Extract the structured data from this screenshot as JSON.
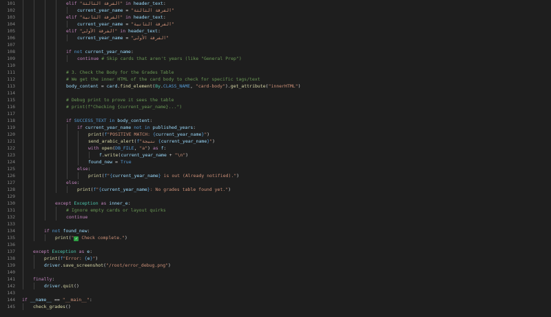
{
  "editor": {
    "lines": [
      {
        "n": "101",
        "indent": 96,
        "t": [
          [
            "elif ",
            "kw"
          ],
          [
            "\"الفرقة الثالثة\"",
            "str"
          ],
          [
            " in ",
            "kw"
          ],
          [
            "header_text",
            "var"
          ],
          [
            ":",
            ""
          ]
        ]
      },
      {
        "n": "102",
        "indent": 112,
        "t": [
          [
            "current_year_name",
            "var"
          ],
          [
            " = ",
            ""
          ],
          [
            "\"الفرقة الثالثة\"",
            "str"
          ]
        ]
      },
      {
        "n": "103",
        "indent": 96,
        "t": [
          [
            "elif ",
            "kw"
          ],
          [
            "\"الفرقة الثانية\"",
            "str"
          ],
          [
            " in ",
            "kw"
          ],
          [
            "header_text",
            "var"
          ],
          [
            ":",
            ""
          ]
        ]
      },
      {
        "n": "104",
        "indent": 112,
        "t": [
          [
            "current_year_name",
            "var"
          ],
          [
            " = ",
            ""
          ],
          [
            "\"الفرقة الثانية\"",
            "str"
          ]
        ]
      },
      {
        "n": "105",
        "indent": 96,
        "t": [
          [
            "elif ",
            "kw"
          ],
          [
            "\"الفرقة الأولى\"",
            "str"
          ],
          [
            " in ",
            "kw"
          ],
          [
            "header_text",
            "var"
          ],
          [
            ":",
            ""
          ]
        ]
      },
      {
        "n": "106",
        "indent": 112,
        "t": [
          [
            "current_year_name",
            "var"
          ],
          [
            " = ",
            ""
          ],
          [
            "\"الفرقة الأولى\"",
            "str"
          ]
        ]
      },
      {
        "n": "107",
        "indent": 0,
        "t": []
      },
      {
        "n": "108",
        "indent": 96,
        "t": [
          [
            "if ",
            "kw"
          ],
          [
            "not ",
            "kb"
          ],
          [
            "current_year_name",
            "var"
          ],
          [
            ":",
            ""
          ]
        ]
      },
      {
        "n": "109",
        "indent": 112,
        "t": [
          [
            "continue ",
            "kw"
          ],
          [
            "# Skip cards that aren't years (like \"General Prep\")",
            "cm"
          ]
        ]
      },
      {
        "n": "110",
        "indent": 0,
        "t": []
      },
      {
        "n": "111",
        "indent": 96,
        "t": [
          [
            "# 3. Check the Body for the Grades Table",
            "cm"
          ]
        ]
      },
      {
        "n": "112",
        "indent": 96,
        "t": [
          [
            "# We get the inner HTML of the card body to check for specific tags/text",
            "cm"
          ]
        ]
      },
      {
        "n": "113",
        "indent": 96,
        "t": [
          [
            "body_content",
            "var"
          ],
          [
            " = ",
            ""
          ],
          [
            "card",
            "var"
          ],
          [
            ".",
            ""
          ],
          [
            "find_element",
            "fn"
          ],
          [
            "(",
            ""
          ],
          [
            "By",
            "cls"
          ],
          [
            ".",
            ""
          ],
          [
            "CLASS_NAME",
            "kb"
          ],
          [
            ", ",
            ""
          ],
          [
            "\"card-body\"",
            "str"
          ],
          [
            ").",
            ""
          ],
          [
            "get_attribute",
            "fn"
          ],
          [
            "(",
            ""
          ],
          [
            "\"innerHTML\"",
            "str"
          ],
          [
            ")",
            ""
          ]
        ]
      },
      {
        "n": "114",
        "indent": 0,
        "t": []
      },
      {
        "n": "115",
        "indent": 96,
        "t": [
          [
            "# Debug print to prove it sees the table",
            "cm"
          ]
        ]
      },
      {
        "n": "116",
        "indent": 96,
        "t": [
          [
            "# print(f\"Checking {current_year_name}...\")",
            "cm"
          ]
        ]
      },
      {
        "n": "117",
        "indent": 0,
        "t": []
      },
      {
        "n": "118",
        "indent": 96,
        "t": [
          [
            "if ",
            "kw"
          ],
          [
            "SUCCESS_TEXT",
            "kb"
          ],
          [
            " in ",
            "kb"
          ],
          [
            "body_content",
            "var"
          ],
          [
            ":",
            ""
          ]
        ]
      },
      {
        "n": "119",
        "indent": 112,
        "t": [
          [
            "if ",
            "kw"
          ],
          [
            "current_year_name",
            "var"
          ],
          [
            " not in ",
            "kb"
          ],
          [
            "published_years",
            "var"
          ],
          [
            ":",
            ""
          ]
        ]
      },
      {
        "n": "120",
        "indent": 128,
        "t": [
          [
            "print",
            "fn"
          ],
          [
            "(",
            ""
          ],
          [
            "f",
            "kb"
          ],
          [
            "\"POSITIVE MATCH: ",
            "str"
          ],
          [
            "{",
            "brace"
          ],
          [
            "current_year_name",
            "var"
          ],
          [
            "}",
            "brace"
          ],
          [
            "\"",
            "str"
          ],
          [
            ")",
            ""
          ]
        ]
      },
      {
        "n": "121",
        "indent": 128,
        "t": [
          [
            "send_arabic_alert",
            "fn"
          ],
          [
            "(",
            ""
          ],
          [
            "f",
            "kb"
          ],
          [
            "\"نتيجة ",
            "str"
          ],
          [
            "{",
            "brace"
          ],
          [
            "current_year_name",
            "var"
          ],
          [
            "}",
            "brace"
          ],
          [
            "\"",
            "str"
          ],
          [
            ")",
            ""
          ]
        ]
      },
      {
        "n": "122",
        "indent": 128,
        "t": [
          [
            "with ",
            "kw"
          ],
          [
            "open",
            "fn"
          ],
          [
            "(",
            ""
          ],
          [
            "DB_FILE",
            "kb"
          ],
          [
            ", ",
            ""
          ],
          [
            "\"a\"",
            "str"
          ],
          [
            ") ",
            ""
          ],
          [
            "as ",
            "kw"
          ],
          [
            "f",
            "var"
          ],
          [
            ":",
            ""
          ]
        ]
      },
      {
        "n": "123",
        "indent": 144,
        "t": [
          [
            "f",
            "var"
          ],
          [
            ".",
            ""
          ],
          [
            "write",
            "fn"
          ],
          [
            "(",
            ""
          ],
          [
            "current_year_name",
            "var"
          ],
          [
            " + ",
            ""
          ],
          [
            "\"\\n\"",
            "str"
          ],
          [
            ")",
            ""
          ]
        ]
      },
      {
        "n": "124",
        "indent": 128,
        "t": [
          [
            "found_new",
            "var"
          ],
          [
            " = ",
            ""
          ],
          [
            "True",
            "kb"
          ]
        ]
      },
      {
        "n": "125",
        "indent": 112,
        "t": [
          [
            "else",
            "kw"
          ],
          [
            ":",
            ""
          ]
        ]
      },
      {
        "n": "126",
        "indent": 128,
        "t": [
          [
            "print",
            "fn"
          ],
          [
            "(",
            ""
          ],
          [
            "f",
            "kb"
          ],
          [
            "\"",
            "str"
          ],
          [
            "{",
            "brace"
          ],
          [
            "current_year_name",
            "var"
          ],
          [
            "}",
            "brace"
          ],
          [
            " is out (Already notified).\"",
            "str"
          ],
          [
            ")",
            ""
          ]
        ]
      },
      {
        "n": "127",
        "indent": 96,
        "t": [
          [
            "else",
            "kw"
          ],
          [
            ":",
            ""
          ]
        ]
      },
      {
        "n": "128",
        "indent": 112,
        "t": [
          [
            "print",
            "fn"
          ],
          [
            "(",
            ""
          ],
          [
            "f",
            "kb"
          ],
          [
            "\"",
            "str"
          ],
          [
            "{",
            "brace"
          ],
          [
            "current_year_name",
            "var"
          ],
          [
            "}",
            "brace"
          ],
          [
            ": No grades table found yet.\"",
            "str"
          ],
          [
            ")",
            ""
          ]
        ]
      },
      {
        "n": "129",
        "indent": 0,
        "t": []
      },
      {
        "n": "130",
        "indent": 80,
        "t": [
          [
            "except ",
            "kw"
          ],
          [
            "Exception",
            "cls"
          ],
          [
            " as ",
            "kw"
          ],
          [
            "inner_e",
            "var"
          ],
          [
            ":",
            ""
          ]
        ]
      },
      {
        "n": "131",
        "indent": 96,
        "t": [
          [
            "# Ignore empty cards or layout quirks",
            "cm"
          ]
        ]
      },
      {
        "n": "132",
        "indent": 96,
        "t": [
          [
            "continue",
            "kw"
          ]
        ]
      },
      {
        "n": "133",
        "indent": 0,
        "t": []
      },
      {
        "n": "134",
        "indent": 64,
        "t": [
          [
            "if ",
            "kw"
          ],
          [
            "not ",
            "kb"
          ],
          [
            "found_new",
            "var"
          ],
          [
            ":",
            ""
          ]
        ]
      },
      {
        "n": "135",
        "indent": 80,
        "t": [
          [
            "print",
            "fn"
          ],
          [
            "(",
            ""
          ],
          [
            "\"",
            "str"
          ],
          [
            "✓",
            "emoji"
          ],
          [
            " Check complete.\"",
            "str"
          ],
          [
            ")",
            ""
          ]
        ]
      },
      {
        "n": "136",
        "indent": 0,
        "t": []
      },
      {
        "n": "137",
        "indent": 48,
        "t": [
          [
            "except ",
            "kw"
          ],
          [
            "Exception",
            "cls"
          ],
          [
            " as ",
            "kw"
          ],
          [
            "e",
            "var"
          ],
          [
            ":",
            ""
          ]
        ]
      },
      {
        "n": "138",
        "indent": 64,
        "t": [
          [
            "print",
            "fn"
          ],
          [
            "(",
            ""
          ],
          [
            "f",
            "kb"
          ],
          [
            "\"Error: ",
            "str"
          ],
          [
            "{",
            "brace"
          ],
          [
            "e",
            "var"
          ],
          [
            "}",
            "brace"
          ],
          [
            "\"",
            "str"
          ],
          [
            ")",
            ""
          ]
        ]
      },
      {
        "n": "139",
        "indent": 64,
        "t": [
          [
            "driver",
            "var"
          ],
          [
            ".",
            ""
          ],
          [
            "save_screenshot",
            "fn"
          ],
          [
            "(",
            ""
          ],
          [
            "\"/root/error_debug.png\"",
            "str"
          ],
          [
            ")",
            ""
          ]
        ]
      },
      {
        "n": "140",
        "indent": 0,
        "t": []
      },
      {
        "n": "141",
        "indent": 48,
        "t": [
          [
            "finally",
            "kw"
          ],
          [
            ":",
            ""
          ]
        ]
      },
      {
        "n": "142",
        "indent": 64,
        "t": [
          [
            "driver",
            "var"
          ],
          [
            ".",
            ""
          ],
          [
            "quit",
            "fn"
          ],
          [
            "()",
            ""
          ]
        ]
      },
      {
        "n": "143",
        "indent": 0,
        "t": []
      },
      {
        "n": "144",
        "indent": 32,
        "t": [
          [
            "if ",
            "kw"
          ],
          [
            "__name__",
            "var"
          ],
          [
            " == ",
            ""
          ],
          [
            "\"__main__\"",
            "str"
          ],
          [
            ":",
            ""
          ]
        ]
      },
      {
        "n": "145",
        "indent": 48,
        "t": [
          [
            "check_grades",
            "fn"
          ],
          [
            "()",
            ""
          ]
        ]
      }
    ]
  }
}
